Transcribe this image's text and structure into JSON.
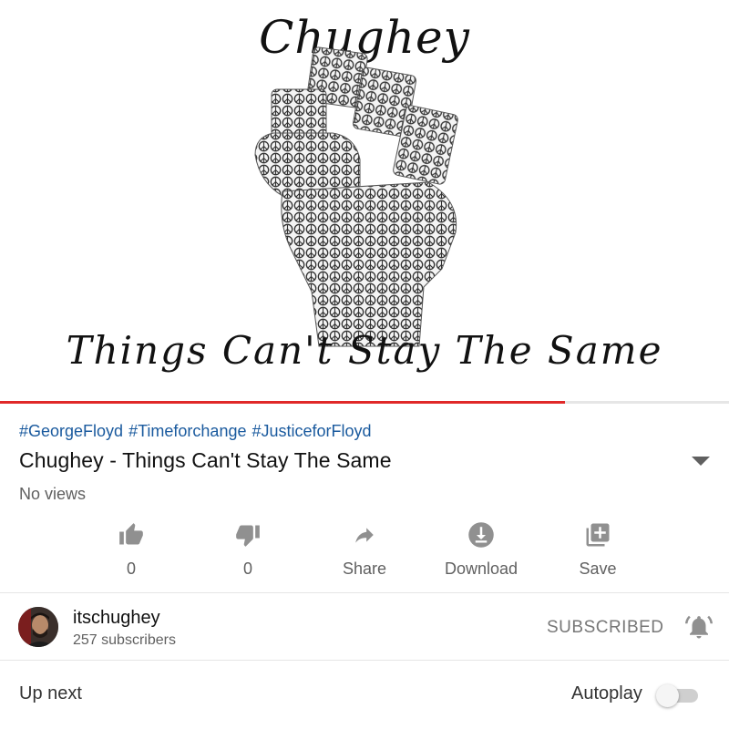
{
  "video": {
    "art_title_top": "Chughey",
    "art_title_bottom": "Things Can't Stay The Same",
    "progress_fraction": 0.775
  },
  "hashtags": [
    "#GeorgeFloyd",
    "#Timeforchange",
    "#JusticeforFloyd"
  ],
  "title": "Chughey - Things Can't Stay The Same",
  "views": "No views",
  "actions": {
    "like_count": "0",
    "dislike_count": "0",
    "share_label": "Share",
    "download_label": "Download",
    "save_label": "Save"
  },
  "channel": {
    "name": "itschughey",
    "subscribers": "257 subscribers",
    "subscribe_state": "SUBSCRIBED"
  },
  "up_next": {
    "label": "Up next",
    "autoplay_label": "Autoplay",
    "autoplay_on": false
  },
  "colors": {
    "progress": "#e02828",
    "hashtag": "#1a5a9e",
    "icon": "#909090"
  },
  "icons": [
    "thumbs-up-icon",
    "thumbs-down-icon",
    "share-icon",
    "download-icon",
    "save-playlist-icon",
    "chevron-down-icon",
    "bell-icon"
  ]
}
